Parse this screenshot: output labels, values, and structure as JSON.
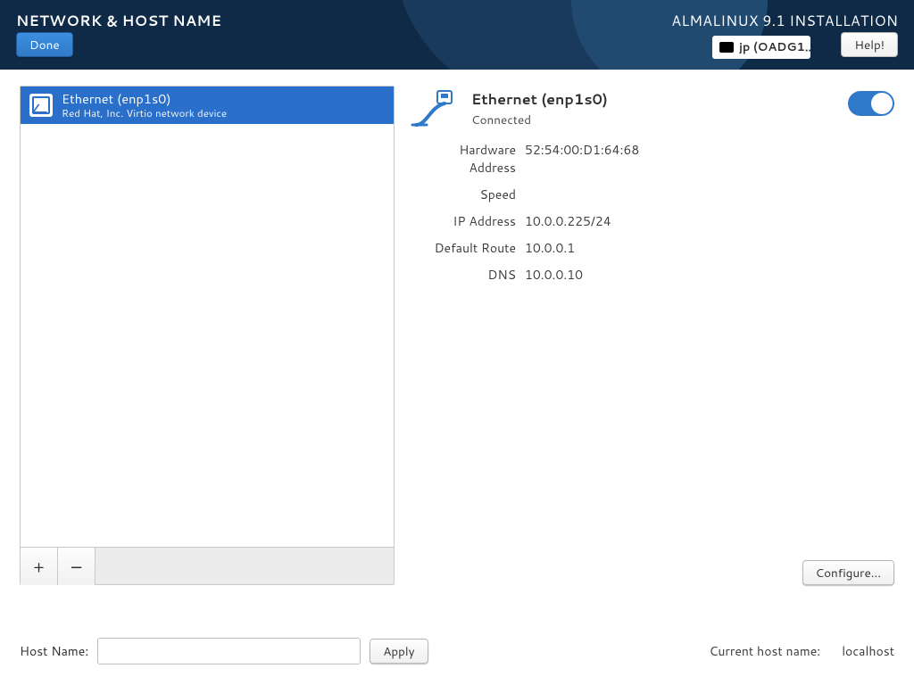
{
  "header": {
    "title_left": "NETWORK & HOST NAME",
    "title_right": "ALMALINUX 9.1 INSTALLATION",
    "done_label": "Done",
    "help_label": "Help!",
    "keyboard_layout": "jp (OADG1…"
  },
  "network_list": {
    "items": [
      {
        "title": "Ethernet (enp1s0)",
        "subtitle": "Red Hat, Inc. Virtio network device"
      }
    ],
    "add_label": "+",
    "remove_label": "−"
  },
  "detail": {
    "title": "Ethernet (enp1s0)",
    "status": "Connected",
    "toggle_on": true,
    "rows": {
      "hardware_address": {
        "label": "Hardware Address",
        "value": "52:54:00:D1:64:68"
      },
      "speed": {
        "label": "Speed",
        "value": ""
      },
      "ip_address": {
        "label": "IP Address",
        "value": "10.0.0.225/24"
      },
      "default_route": {
        "label": "Default Route",
        "value": "10.0.0.1"
      },
      "dns": {
        "label": "DNS",
        "value": "10.0.0.10"
      }
    },
    "configure_label": "Configure..."
  },
  "hostname": {
    "label": "Host Name:",
    "value": "",
    "apply_label": "Apply",
    "current_label": "Current host name:",
    "current_value": "localhost"
  }
}
